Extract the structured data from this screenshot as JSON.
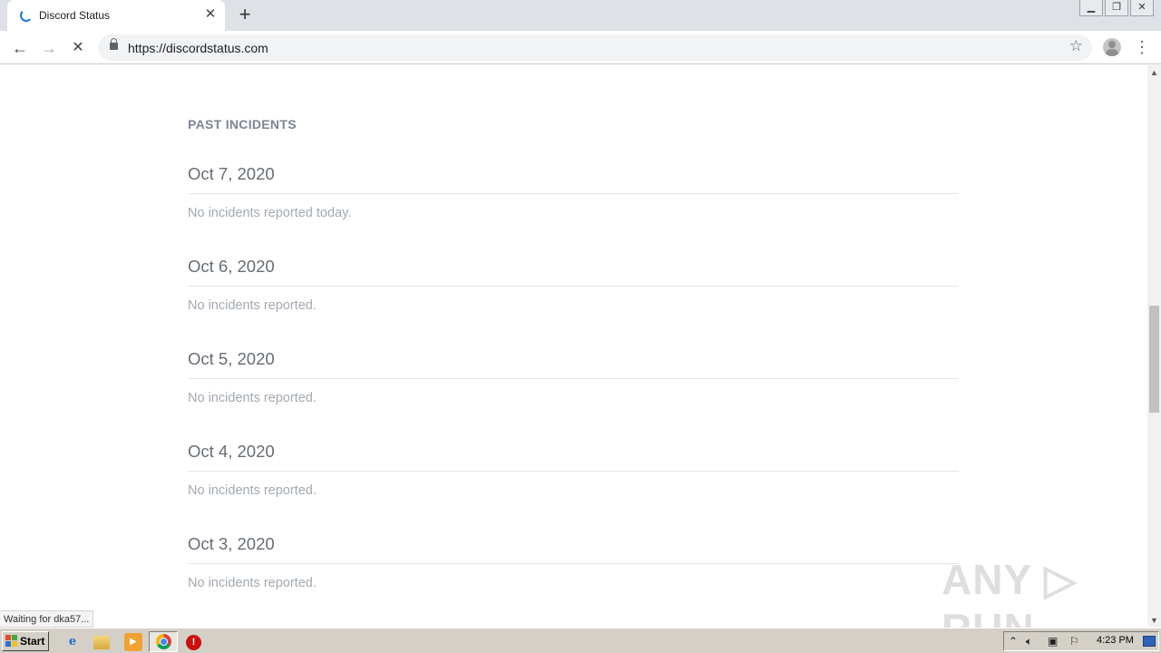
{
  "browser": {
    "tab_title": "Discord Status",
    "tab_close": "✕",
    "new_tab": "+",
    "url": "https://discordstatus.com",
    "status_bubble": "Waiting for dka57..."
  },
  "page": {
    "section_title": "PAST INCIDENTS",
    "days": [
      {
        "date": "Oct 7, 2020",
        "message": "No incidents reported today."
      },
      {
        "date": "Oct 6, 2020",
        "message": "No incidents reported."
      },
      {
        "date": "Oct 5, 2020",
        "message": "No incidents reported."
      },
      {
        "date": "Oct 4, 2020",
        "message": "No incidents reported."
      },
      {
        "date": "Oct 3, 2020",
        "message": "No incidents reported."
      }
    ],
    "watermark": "ANY ▷ RUN"
  },
  "taskbar": {
    "start_label": "Start",
    "clock": "4:23 PM"
  }
}
